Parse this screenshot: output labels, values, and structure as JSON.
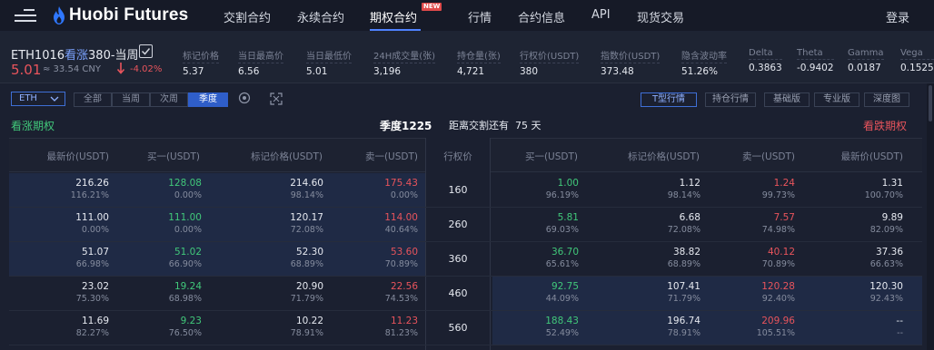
{
  "nav": {
    "logo": "Huobi Futures",
    "items": [
      "交割合约",
      "永续合约",
      "期权合约",
      "行情",
      "合约信息",
      "API",
      "现货交易"
    ],
    "new_badge": "NEW",
    "login": "登录"
  },
  "ticker": {
    "symbol_prefix": "ETH1016",
    "symbol_type": "看涨",
    "symbol_suffix": "380-当周",
    "price": "5.01",
    "cny": "≈ 33.54 CNY",
    "change": "-4.02%",
    "stats": [
      {
        "label": "标记价格",
        "value": "5.37"
      },
      {
        "label": "当日最高价",
        "value": "6.56"
      },
      {
        "label": "当日最低价",
        "value": "5.01"
      },
      {
        "label": "24H成交量(张)",
        "value": "3,196"
      },
      {
        "label": "持仓量(张)",
        "value": "4,721"
      },
      {
        "label": "行权价(USDT)",
        "value": "380"
      },
      {
        "label": "指数价(USDT)",
        "value": "373.48"
      },
      {
        "label": "隐含波动率",
        "value": "51.26%"
      },
      {
        "label": "Delta",
        "value": "0.3863"
      },
      {
        "label": "Theta",
        "value": "-0.9402"
      },
      {
        "label": "Gamma",
        "value": "0.0187"
      },
      {
        "label": "Vega",
        "value": "0.1525"
      }
    ]
  },
  "filters": {
    "asset": "ETH",
    "periods": [
      "全部",
      "当周",
      "次周",
      "季度"
    ],
    "active_period": "季度",
    "views": [
      "T型行情",
      "持仓行情",
      "基础版",
      "专业版",
      "深度图"
    ],
    "active_view": "T型行情"
  },
  "section": {
    "call_title": "看涨期权",
    "put_title": "看跌期权",
    "expiry": "季度1225",
    "days_label": "距离交割还有",
    "days_value": "75 天"
  },
  "table": {
    "call_headers": [
      "最新价(USDT)",
      "买一(USDT)",
      "标记价格(USDT)",
      "卖一(USDT)"
    ],
    "strike_header": "行权价",
    "put_headers": [
      "买一(USDT)",
      "标记价格(USDT)",
      "卖一(USDT)",
      "最新价(USDT)"
    ],
    "rows": [
      {
        "strike": "160",
        "call": [
          [
            "216.26",
            "116.21%"
          ],
          [
            "128.08",
            "0.00%"
          ],
          [
            "214.60",
            "98.14%"
          ],
          [
            "175.43",
            "0.00%"
          ]
        ],
        "put": [
          [
            "1.00",
            "96.19%"
          ],
          [
            "1.12",
            "98.14%"
          ],
          [
            "1.24",
            "99.73%"
          ],
          [
            "1.31",
            "100.70%"
          ]
        ],
        "call_itm": true
      },
      {
        "strike": "260",
        "call": [
          [
            "111.00",
            "0.00%"
          ],
          [
            "111.00",
            "0.00%"
          ],
          [
            "120.17",
            "72.08%"
          ],
          [
            "114.00",
            "40.64%"
          ]
        ],
        "put": [
          [
            "5.81",
            "69.03%"
          ],
          [
            "6.68",
            "72.08%"
          ],
          [
            "7.57",
            "74.98%"
          ],
          [
            "9.89",
            "82.09%"
          ]
        ],
        "call_itm": true
      },
      {
        "strike": "360",
        "call": [
          [
            "51.07",
            "66.98%"
          ],
          [
            "51.02",
            "66.90%"
          ],
          [
            "52.30",
            "68.89%"
          ],
          [
            "53.60",
            "70.89%"
          ]
        ],
        "put": [
          [
            "36.70",
            "65.61%"
          ],
          [
            "38.82",
            "68.89%"
          ],
          [
            "40.12",
            "70.89%"
          ],
          [
            "37.36",
            "66.63%"
          ]
        ],
        "call_itm": true
      },
      {
        "strike": "460",
        "call": [
          [
            "23.02",
            "75.30%"
          ],
          [
            "19.24",
            "68.98%"
          ],
          [
            "20.90",
            "71.79%"
          ],
          [
            "22.56",
            "74.53%"
          ]
        ],
        "put": [
          [
            "92.75",
            "44.09%"
          ],
          [
            "107.41",
            "71.79%"
          ],
          [
            "120.28",
            "92.40%"
          ],
          [
            "120.30",
            "92.43%"
          ]
        ],
        "call_itm": false
      },
      {
        "strike": "560",
        "call": [
          [
            "11.69",
            "82.27%"
          ],
          [
            "9.23",
            "76.50%"
          ],
          [
            "10.22",
            "78.91%"
          ],
          [
            "11.23",
            "81.23%"
          ]
        ],
        "put": [
          [
            "188.43",
            "52.49%"
          ],
          [
            "196.74",
            "78.91%"
          ],
          [
            "209.96",
            "105.51%"
          ],
          [
            "--",
            "--"
          ]
        ],
        "call_itm": false
      }
    ]
  },
  "colors": {
    "background": "#1b2030",
    "call_green": "#41c87a",
    "put_red": "#e8545c",
    "accent_blue": "#2f5ec9",
    "itm_highlight": "#1f2a45"
  }
}
